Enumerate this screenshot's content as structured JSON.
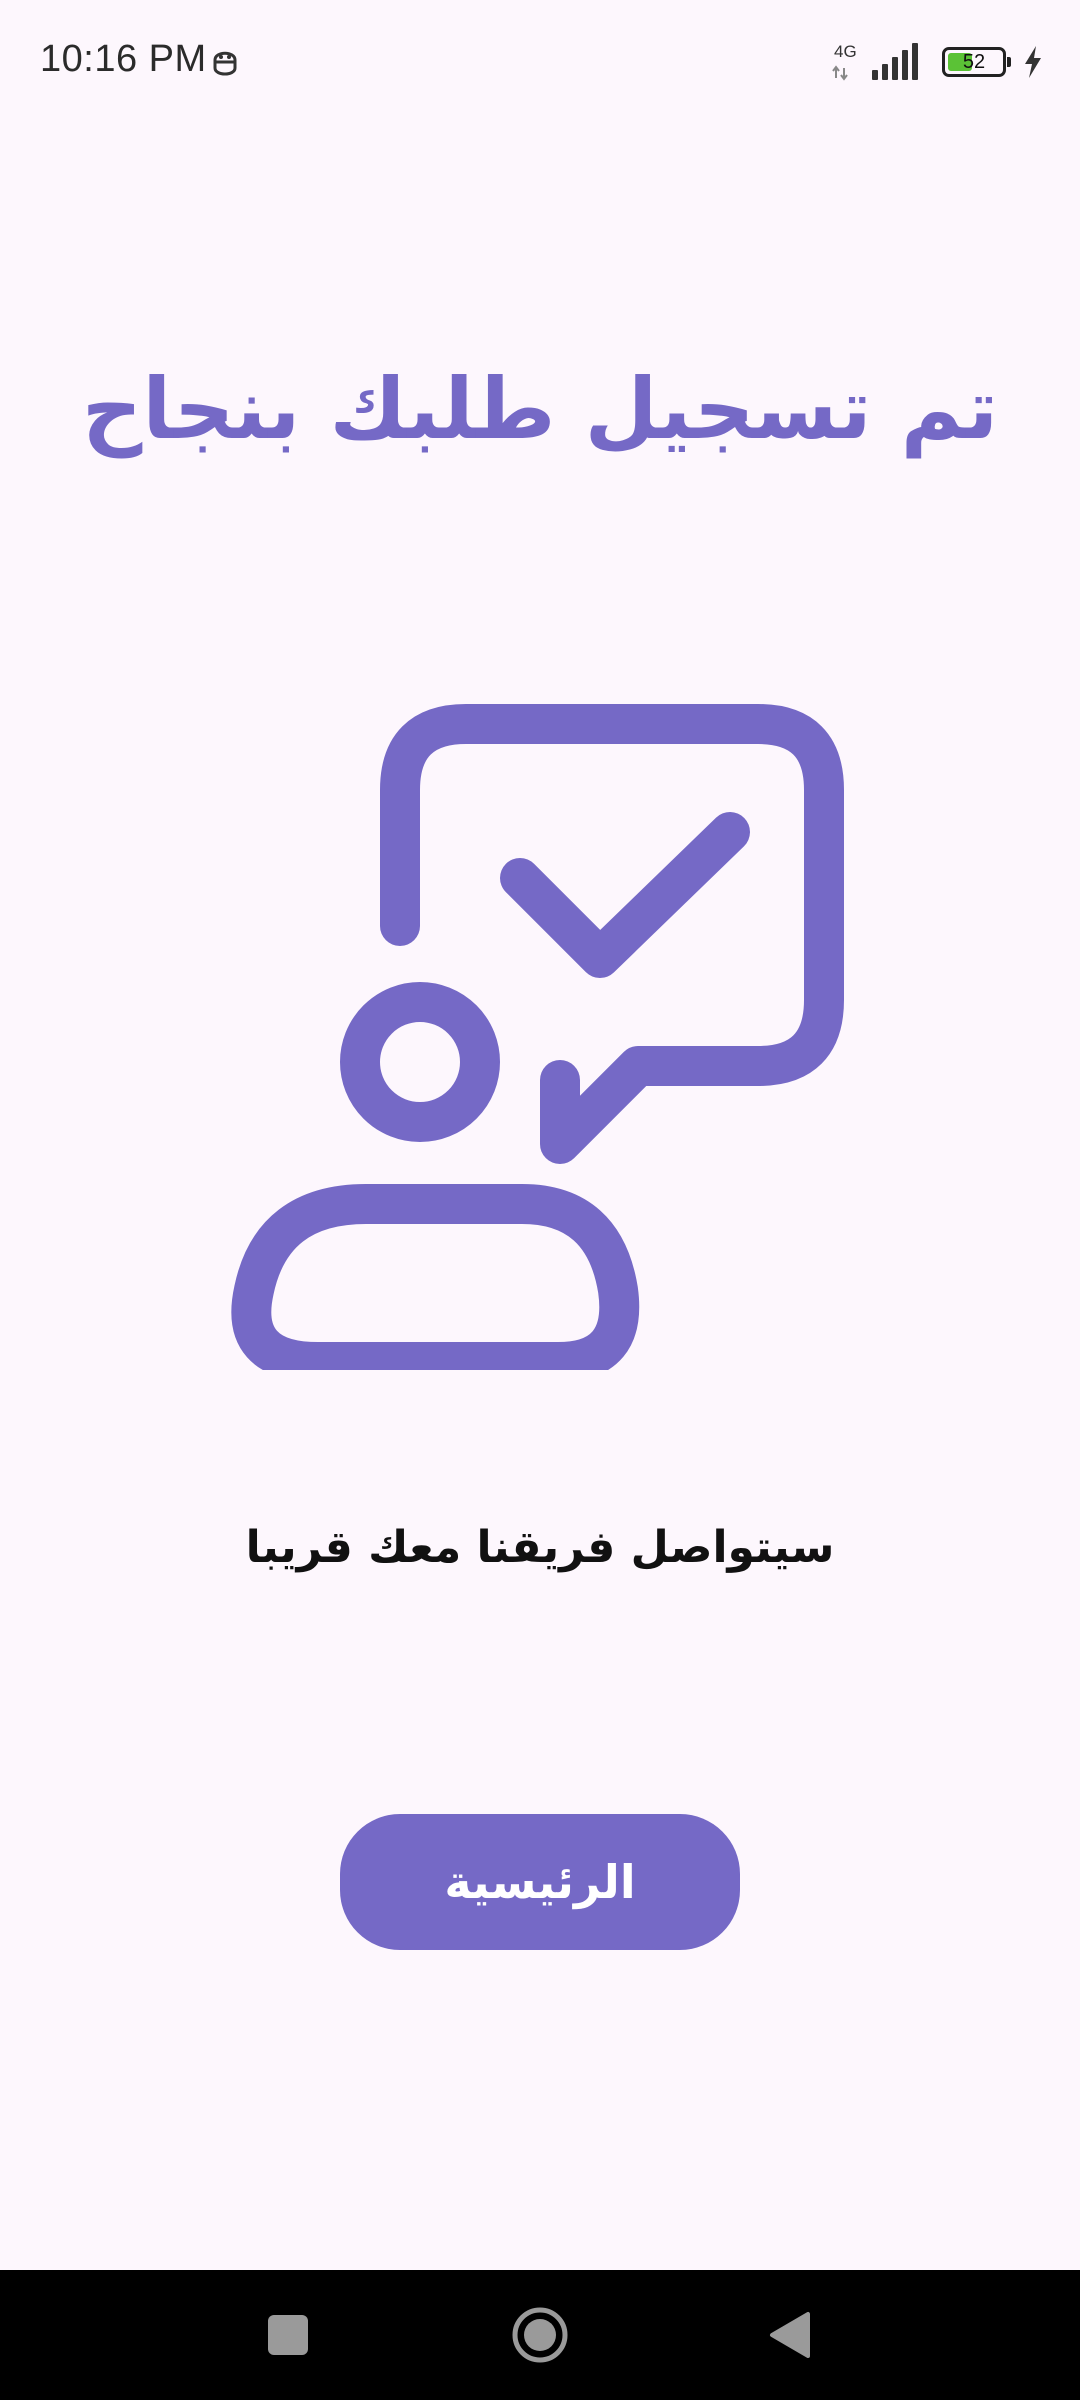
{
  "status_bar": {
    "time": "10:16 PM",
    "network_type": "4G",
    "battery_level": "52",
    "battery_fraction": 0.52,
    "notification_icon": "emoji-face-icon",
    "signal_icon": "signal-bars-icon",
    "charging_icon": "charging-bolt-icon"
  },
  "main": {
    "title": "تم تسجيل طلبك بنجاح",
    "illustration_icon": "person-chat-check-icon",
    "subtitle": "سيتواصل فريقنا معك قريبا",
    "home_button_label": "الرئيسية"
  },
  "nav_bar": {
    "recent_icon": "recent-apps-icon",
    "home_icon": "home-circle-icon",
    "back_icon": "back-triangle-icon"
  },
  "colors": {
    "accent": "#7569c6",
    "background": "#fdf7fd",
    "text": "#111111",
    "nav_bar": "#000000",
    "battery": "#5bc236"
  }
}
